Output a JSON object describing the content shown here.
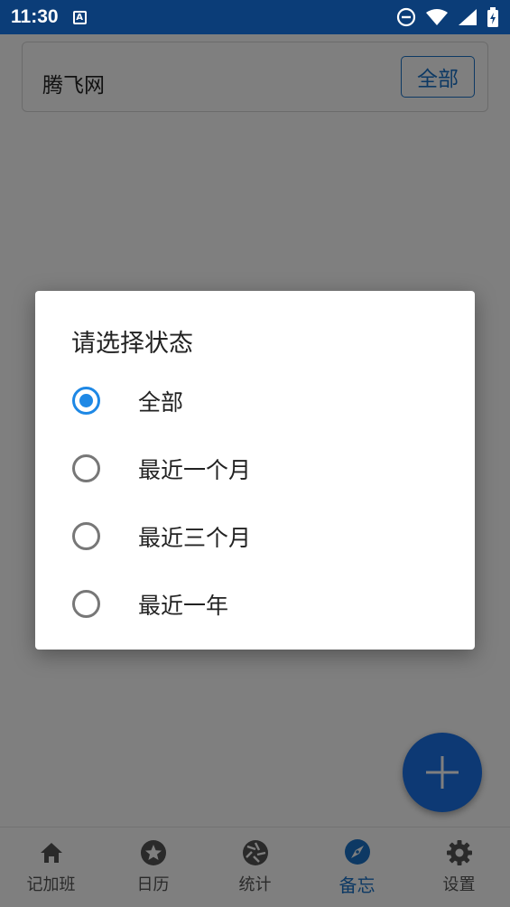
{
  "status_bar": {
    "time": "11:30",
    "notification_glyph": "A",
    "icons": [
      "do-not-disturb-icon",
      "wifi-icon",
      "signal-icon",
      "battery-icon"
    ]
  },
  "search": {
    "text": "腾飞网",
    "filter_label": "全部"
  },
  "dialog": {
    "title": "请选择状态",
    "options": [
      {
        "label": "全部",
        "checked": true
      },
      {
        "label": "最近一个月",
        "checked": false
      },
      {
        "label": "最近三个月",
        "checked": false
      },
      {
        "label": "最近一年",
        "checked": false
      }
    ]
  },
  "bottom_nav": {
    "items": [
      {
        "label": "记加班",
        "icon": "home-icon",
        "active": false
      },
      {
        "label": "日历",
        "icon": "star-circle-icon",
        "active": false
      },
      {
        "label": "统计",
        "icon": "aperture-icon",
        "active": false
      },
      {
        "label": "备忘",
        "icon": "compass-icon",
        "active": true
      },
      {
        "label": "设置",
        "icon": "gear-icon",
        "active": false
      }
    ]
  },
  "colors": {
    "status_bar": "#0b3d78",
    "accent": "#1a73c9",
    "fab": "#1a73e8",
    "radio_checked": "#1e88e5"
  }
}
